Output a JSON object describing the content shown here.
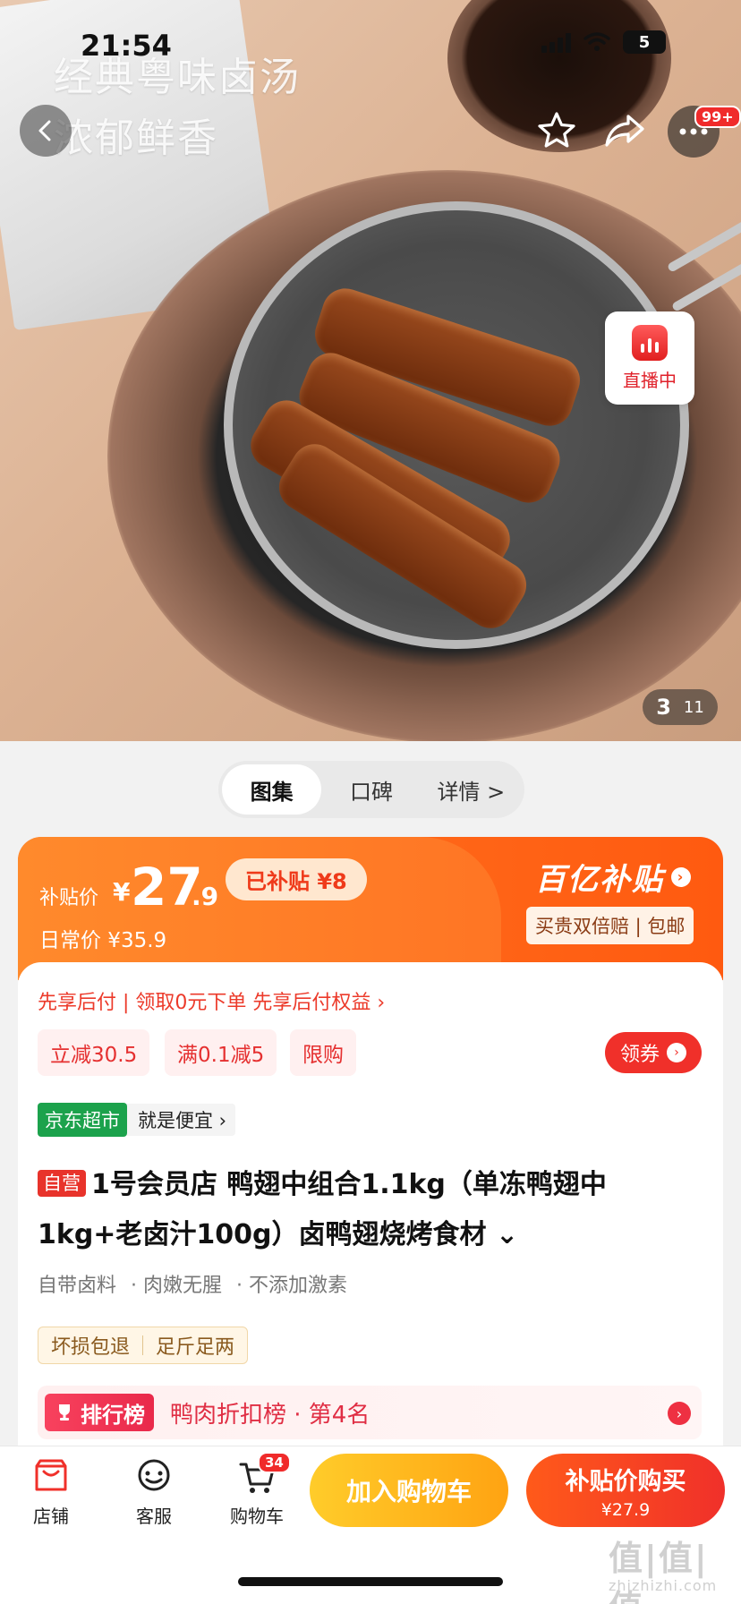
{
  "status_bar": {
    "time": "21:54",
    "battery": "5"
  },
  "hero": {
    "overlay_line1": "经典粤味卤汤",
    "overlay_line2": "浓郁鲜香",
    "live_label": "直播中",
    "image_index": "3",
    "image_total": "11",
    "more_badge": "99+"
  },
  "tabs": [
    {
      "label": "图集",
      "active": true
    },
    {
      "label": "口碑",
      "active": false
    },
    {
      "label": "详情 >",
      "active": false
    }
  ],
  "price": {
    "subsidy_label": "补贴价",
    "currency": "¥",
    "integer": "27",
    "decimal": ".9",
    "subsidy_pill": "已补贴 ¥8",
    "daily_label": "日常价 ¥35.9",
    "brand": "百亿补贴",
    "brand_sub": "买贵双倍赔 | 包邮"
  },
  "paylater": "先享后付 | 领取0元下单 先享后付权益 ›",
  "promos": [
    "立减30.5",
    "满0.1减5",
    "限购"
  ],
  "coupon_label": "领券",
  "store": {
    "tag": "京东超市",
    "text": "就是便宜 ›"
  },
  "product": {
    "self_tag": "自营",
    "title": "1号会员店 鸭翅中组合1.1kg（单冻鸭翅中1kg+老卤汁100g）卤鸭翅烧烤食材 ⌄",
    "features": [
      "自带卤料",
      "· 肉嫩无腥",
      "· 不添加激素"
    ],
    "guarantees": [
      "坏损包退",
      "足斤足两"
    ]
  },
  "ranking": {
    "badge": "排行榜",
    "text": "鸭肉折扣榜 · 第4名"
  },
  "bottom_bar": {
    "store": "店铺",
    "service": "客服",
    "cart": "购物车",
    "cart_count": "34",
    "add_to_cart": "加入购物车",
    "buy_line1": "补贴价购买",
    "buy_line2": "¥27.9"
  },
  "watermark": {
    "main": "值|值|值",
    "sub": "zhizhizhi.com"
  }
}
